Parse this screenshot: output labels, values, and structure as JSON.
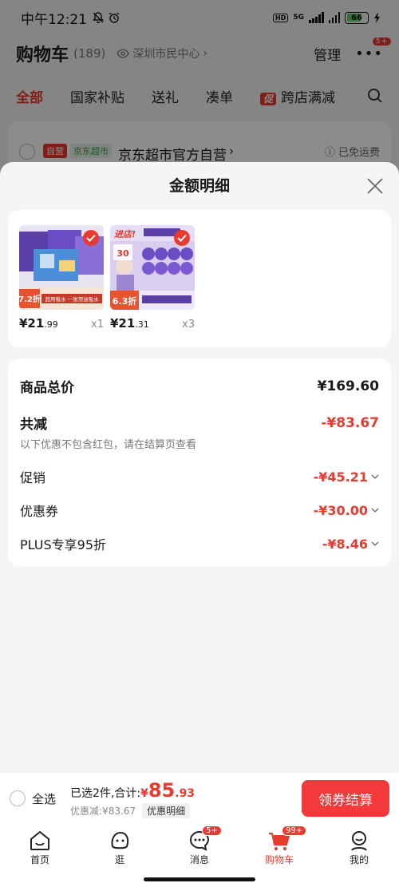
{
  "status_bar": {
    "time": "中午12:21",
    "network": "5G",
    "battery": "66"
  },
  "header": {
    "title": "购物车",
    "count": "(189)",
    "location": "深圳市民中心",
    "manage": "管理",
    "more_badge": "5+"
  },
  "tabs": [
    {
      "label": "全部",
      "active": true
    },
    {
      "label": "国家补贴"
    },
    {
      "label": "送礼"
    },
    {
      "label": "凑单"
    },
    {
      "label": "跨店满减",
      "promo_tag": "促"
    }
  ],
  "store": {
    "tag_self": "自营",
    "tag_jd": "京东超市",
    "name": "京东超市官方自营",
    "shipping": "已免运费"
  },
  "sheet": {
    "title": "金额明细",
    "items": [
      {
        "price_int": "¥21",
        "price_dec": ".99",
        "qty": "x1",
        "badge": "7.2折",
        "banner": "超用吸水 一张顶油吸水"
      },
      {
        "price_int": "¥21",
        "price_dec": ".31",
        "qty": "x3",
        "banner_top": "进店!",
        "badge": "6.3折",
        "promo_mid": "30"
      }
    ],
    "summary": {
      "total_label": "商品总价",
      "total_value": "¥169.60",
      "reduce_label": "共减",
      "reduce_value": "-¥83.67",
      "note": "以下优惠不包含红包，请在结算页查看",
      "lines": [
        {
          "label": "促销",
          "value": "-¥45.21"
        },
        {
          "label": "优惠券",
          "value": "-¥30.00"
        },
        {
          "label": "PLUS专享95折",
          "value": "-¥8.46"
        }
      ]
    }
  },
  "checkout": {
    "select_all": "全选",
    "selected_text": "已选2件,合计:",
    "total_symbol": "¥",
    "total_int": "85",
    "total_dec": ".93",
    "discount_text": "优惠减:¥83.67",
    "detail_chip": "优惠明细",
    "button": "领券结算"
  },
  "tabbar": [
    {
      "label": "首页"
    },
    {
      "label": "逛"
    },
    {
      "label": "消息",
      "badge": "5+"
    },
    {
      "label": "购物车",
      "badge": "99+",
      "active": true
    },
    {
      "label": "我的"
    }
  ],
  "colors": {
    "accent": "#e83a2f",
    "button": "#f23a3a"
  }
}
